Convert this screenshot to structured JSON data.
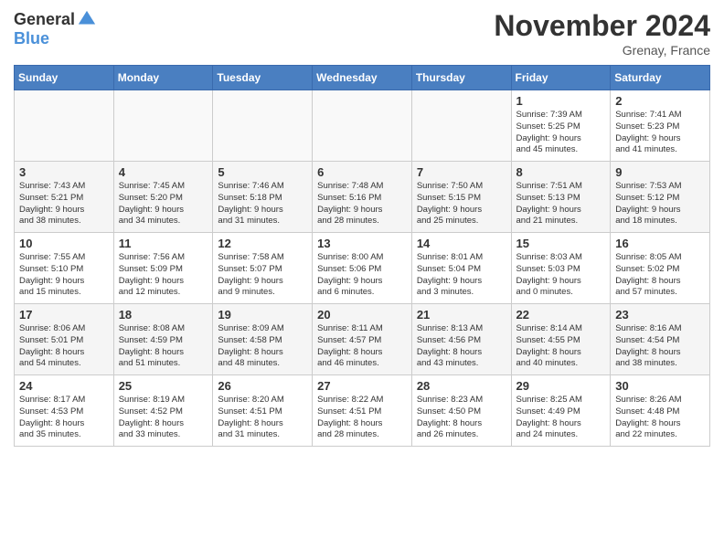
{
  "logo": {
    "general": "General",
    "blue": "Blue"
  },
  "header": {
    "title": "November 2024",
    "location": "Grenay, France"
  },
  "days_of_week": [
    "Sunday",
    "Monday",
    "Tuesday",
    "Wednesday",
    "Thursday",
    "Friday",
    "Saturday"
  ],
  "weeks": [
    [
      {
        "day": "",
        "info": ""
      },
      {
        "day": "",
        "info": ""
      },
      {
        "day": "",
        "info": ""
      },
      {
        "day": "",
        "info": ""
      },
      {
        "day": "",
        "info": ""
      },
      {
        "day": "1",
        "info": "Sunrise: 7:39 AM\nSunset: 5:25 PM\nDaylight: 9 hours\nand 45 minutes."
      },
      {
        "day": "2",
        "info": "Sunrise: 7:41 AM\nSunset: 5:23 PM\nDaylight: 9 hours\nand 41 minutes."
      }
    ],
    [
      {
        "day": "3",
        "info": "Sunrise: 7:43 AM\nSunset: 5:21 PM\nDaylight: 9 hours\nand 38 minutes."
      },
      {
        "day": "4",
        "info": "Sunrise: 7:45 AM\nSunset: 5:20 PM\nDaylight: 9 hours\nand 34 minutes."
      },
      {
        "day": "5",
        "info": "Sunrise: 7:46 AM\nSunset: 5:18 PM\nDaylight: 9 hours\nand 31 minutes."
      },
      {
        "day": "6",
        "info": "Sunrise: 7:48 AM\nSunset: 5:16 PM\nDaylight: 9 hours\nand 28 minutes."
      },
      {
        "day": "7",
        "info": "Sunrise: 7:50 AM\nSunset: 5:15 PM\nDaylight: 9 hours\nand 25 minutes."
      },
      {
        "day": "8",
        "info": "Sunrise: 7:51 AM\nSunset: 5:13 PM\nDaylight: 9 hours\nand 21 minutes."
      },
      {
        "day": "9",
        "info": "Sunrise: 7:53 AM\nSunset: 5:12 PM\nDaylight: 9 hours\nand 18 minutes."
      }
    ],
    [
      {
        "day": "10",
        "info": "Sunrise: 7:55 AM\nSunset: 5:10 PM\nDaylight: 9 hours\nand 15 minutes."
      },
      {
        "day": "11",
        "info": "Sunrise: 7:56 AM\nSunset: 5:09 PM\nDaylight: 9 hours\nand 12 minutes."
      },
      {
        "day": "12",
        "info": "Sunrise: 7:58 AM\nSunset: 5:07 PM\nDaylight: 9 hours\nand 9 minutes."
      },
      {
        "day": "13",
        "info": "Sunrise: 8:00 AM\nSunset: 5:06 PM\nDaylight: 9 hours\nand 6 minutes."
      },
      {
        "day": "14",
        "info": "Sunrise: 8:01 AM\nSunset: 5:04 PM\nDaylight: 9 hours\nand 3 minutes."
      },
      {
        "day": "15",
        "info": "Sunrise: 8:03 AM\nSunset: 5:03 PM\nDaylight: 9 hours\nand 0 minutes."
      },
      {
        "day": "16",
        "info": "Sunrise: 8:05 AM\nSunset: 5:02 PM\nDaylight: 8 hours\nand 57 minutes."
      }
    ],
    [
      {
        "day": "17",
        "info": "Sunrise: 8:06 AM\nSunset: 5:01 PM\nDaylight: 8 hours\nand 54 minutes."
      },
      {
        "day": "18",
        "info": "Sunrise: 8:08 AM\nSunset: 4:59 PM\nDaylight: 8 hours\nand 51 minutes."
      },
      {
        "day": "19",
        "info": "Sunrise: 8:09 AM\nSunset: 4:58 PM\nDaylight: 8 hours\nand 48 minutes."
      },
      {
        "day": "20",
        "info": "Sunrise: 8:11 AM\nSunset: 4:57 PM\nDaylight: 8 hours\nand 46 minutes."
      },
      {
        "day": "21",
        "info": "Sunrise: 8:13 AM\nSunset: 4:56 PM\nDaylight: 8 hours\nand 43 minutes."
      },
      {
        "day": "22",
        "info": "Sunrise: 8:14 AM\nSunset: 4:55 PM\nDaylight: 8 hours\nand 40 minutes."
      },
      {
        "day": "23",
        "info": "Sunrise: 8:16 AM\nSunset: 4:54 PM\nDaylight: 8 hours\nand 38 minutes."
      }
    ],
    [
      {
        "day": "24",
        "info": "Sunrise: 8:17 AM\nSunset: 4:53 PM\nDaylight: 8 hours\nand 35 minutes."
      },
      {
        "day": "25",
        "info": "Sunrise: 8:19 AM\nSunset: 4:52 PM\nDaylight: 8 hours\nand 33 minutes."
      },
      {
        "day": "26",
        "info": "Sunrise: 8:20 AM\nSunset: 4:51 PM\nDaylight: 8 hours\nand 31 minutes."
      },
      {
        "day": "27",
        "info": "Sunrise: 8:22 AM\nSunset: 4:51 PM\nDaylight: 8 hours\nand 28 minutes."
      },
      {
        "day": "28",
        "info": "Sunrise: 8:23 AM\nSunset: 4:50 PM\nDaylight: 8 hours\nand 26 minutes."
      },
      {
        "day": "29",
        "info": "Sunrise: 8:25 AM\nSunset: 4:49 PM\nDaylight: 8 hours\nand 24 minutes."
      },
      {
        "day": "30",
        "info": "Sunrise: 8:26 AM\nSunset: 4:48 PM\nDaylight: 8 hours\nand 22 minutes."
      }
    ]
  ]
}
